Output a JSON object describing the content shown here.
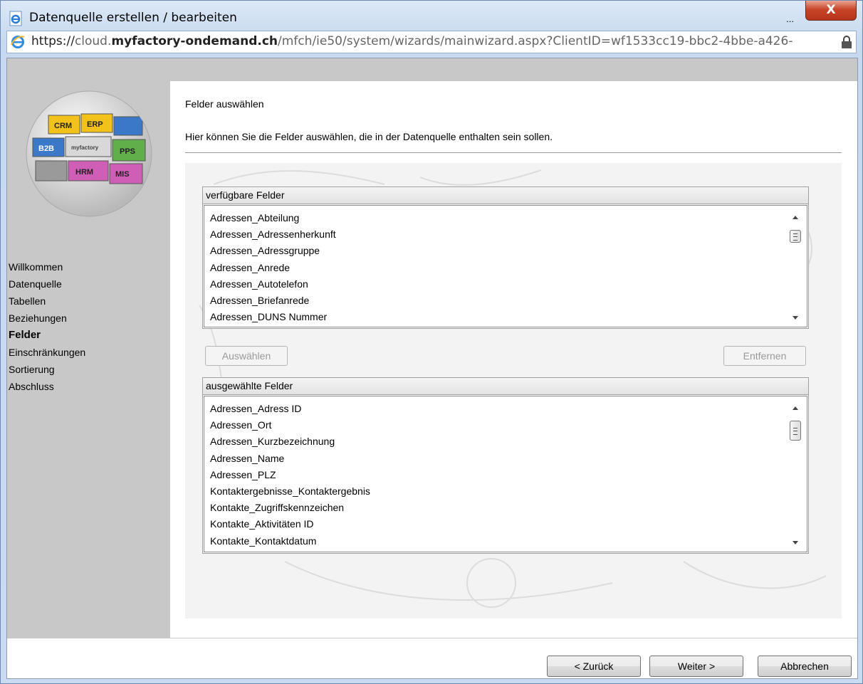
{
  "window": {
    "title": "Datenquelle erstellen / bearbeiten",
    "title_dots": "...",
    "close_label": "X",
    "url_scheme": "https://",
    "url_pre": "cloud.",
    "url_host": "myfactory-ondemand.ch",
    "url_path": "/mfch/ie50/system/wizards/mainwizard.aspx?ClientID=wf1533cc19-bbc2-4bbe-a426-"
  },
  "logo": {
    "pieces": [
      "CRM",
      "ERP",
      "B2B",
      "myfactory",
      "PPS",
      "HRM",
      "MIS"
    ],
    "colors": {
      "crm": "#f2c21a",
      "erp": "#f2c21a",
      "blue": "#3b78c8",
      "green": "#5fb04b",
      "pink": "#cf5fb6",
      "grey": "#9a9a9a"
    }
  },
  "nav": {
    "items": [
      "Willkommen",
      "Datenquelle",
      "Tabellen",
      "Beziehungen",
      "Felder",
      "Einschränkungen",
      "Sortierung",
      "Abschluss"
    ],
    "active": "Felder"
  },
  "page": {
    "heading": "Felder auswählen",
    "description": "Hier können Sie die Felder auswählen, die in der Datenquelle enthalten sein sollen."
  },
  "available": {
    "title": "verfügbare Felder",
    "items": [
      "Adressen_Abteilung",
      "Adressen_Adressenherkunft",
      "Adressen_Adressgruppe",
      "Adressen_Anrede",
      "Adressen_Autotelefon",
      "Adressen_Briefanrede",
      "Adressen_DUNS Nummer"
    ]
  },
  "selected": {
    "title": "ausgewählte Felder",
    "items": [
      "Adressen_Adress ID",
      "Adressen_Ort",
      "Adressen_Kurzbezeichnung",
      "Adressen_Name",
      "Adressen_PLZ",
      "Kontaktergebnisse_Kontaktergebnis",
      "Kontakte_Zugriffskennzeichen",
      "Kontakte_Aktivitäten ID",
      "Kontakte_Kontaktdatum"
    ]
  },
  "buttons": {
    "select": "Auswählen",
    "remove": "Entfernen",
    "back": "< Zurück",
    "next": "Weiter >",
    "cancel": "Abbrechen"
  }
}
